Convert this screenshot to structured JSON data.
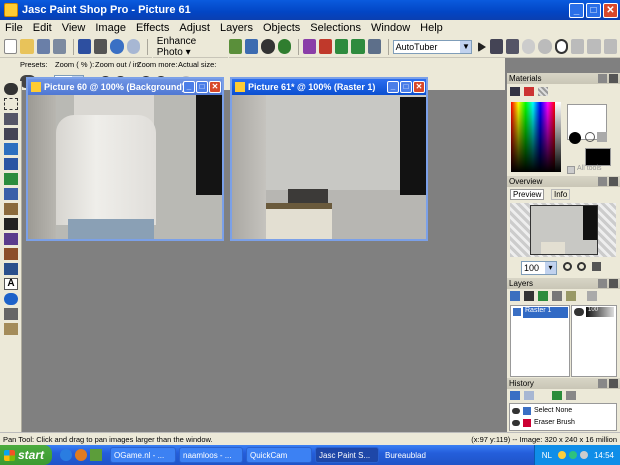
{
  "window": {
    "title": "Jasc Paint Shop Pro - Picture 61",
    "minimize": "_",
    "maximize": "□",
    "close": "✕"
  },
  "menu": [
    "File",
    "Edit",
    "View",
    "Image",
    "Effects",
    "Adjust",
    "Layers",
    "Objects",
    "Selections",
    "Window",
    "Help"
  ],
  "toolbar": {
    "enhance_label": "Enhance Photo",
    "script_value": "AutoTuber"
  },
  "tool_options": {
    "presets_label": "Presets:",
    "zoom_pct_label": "Zoom ( % ):",
    "zoom_out_label": "Zoom out / in:",
    "zoom_more_label": "Zoom more:",
    "actual_size_label": "Actual size:",
    "zoom_value": "100"
  },
  "documents": [
    {
      "title": "Picture 60 @ 100% (Background)",
      "active": false
    },
    {
      "title": "Picture 61* @ 100% (Raster 1)",
      "active": true
    }
  ],
  "panels": {
    "materials": {
      "title": "Materials",
      "all_tools_label": "All tools"
    },
    "overview": {
      "title": "Overview",
      "tab_preview": "Preview",
      "tab_info": "Info",
      "zoom_value": "100"
    },
    "layers": {
      "title": "Layers",
      "layer_name": "Raster 1",
      "opacity": "100"
    },
    "history": {
      "title": "History",
      "items": [
        "Select None",
        "Eraser Brush"
      ]
    }
  },
  "status": {
    "left": "Pan Tool: Click and drag to pan images larger than the window.",
    "right": "(x:97 y:119) -- Image:  320 x 240 x 16 million"
  },
  "taskbar": {
    "start_label": "start",
    "tasks": [
      "OGame.nl - ...",
      "naamloos - ...",
      "QuickCam",
      "Jasc Paint S...",
      "Bureaublad"
    ],
    "lang": "NL",
    "clock": "14:54"
  },
  "colors": {
    "titlebar": "#0a5bde",
    "workspace": "#808080",
    "chrome": "#ece9d8"
  }
}
